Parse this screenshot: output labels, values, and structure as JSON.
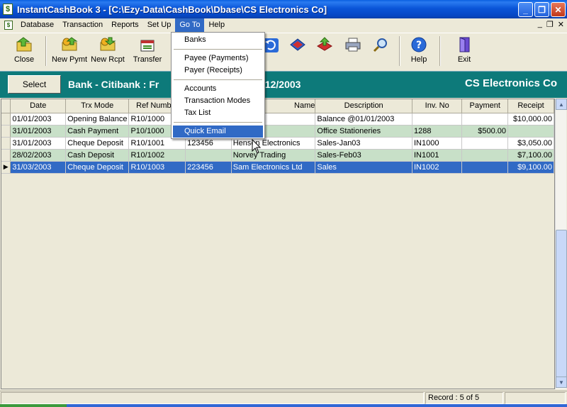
{
  "window": {
    "title": "InstantCashBook  3 - [C:\\Ezy-Data\\CashBook\\Dbase\\CS Electronics Co]",
    "app_icon_glyph": "$",
    "minimize_glyph": "_",
    "restore_glyph": "❐",
    "close_glyph": "✕"
  },
  "menubar": {
    "items": [
      "Database",
      "Transaction",
      "Reports",
      "Set Up",
      "Go To",
      "Help"
    ],
    "active": "Go To",
    "mdi_min": "_",
    "mdi_restore": "❐",
    "mdi_close": "✕"
  },
  "toolbar": {
    "close": "Close",
    "new_pymt": "New Pymt",
    "new_rcpt": "New Rcpt",
    "transfer": "Transfer",
    "help": "Help",
    "exit": "Exit"
  },
  "header": {
    "select_label": "Select",
    "bank_title": "Bank - Citibank  :  Fr",
    "date_tail": "31/12/2003",
    "company": "CS Electronics Co"
  },
  "grid": {
    "columns": [
      "Date",
      "Trx Mode",
      "Ref Number",
      "",
      "Name",
      "Description",
      "Inv. No",
      "Payment",
      "Receipt"
    ],
    "rows": [
      {
        "date": "01/01/2003",
        "mode": "Opening Balance",
        "ref": "R10/1000",
        "chq": "",
        "name": "",
        "desc": "Balance @01/01/2003",
        "inv": "",
        "payment": "",
        "receipt": "$10,000.00",
        "style": "white"
      },
      {
        "date": "31/01/2003",
        "mode": "Cash Payment",
        "ref": "P10/1000",
        "chq": "",
        "name": "eries",
        "desc": "Office Stationeries",
        "inv": "1288",
        "payment": "$500.00",
        "receipt": "",
        "style": "green"
      },
      {
        "date": "31/01/2003",
        "mode": "Cheque Deposit",
        "ref": "R10/1001",
        "chq": "123456",
        "name": "Henson Electronics",
        "desc": "Sales-Jan03",
        "inv": "IN1000",
        "payment": "",
        "receipt": "$3,050.00",
        "style": "white"
      },
      {
        "date": "28/02/2003",
        "mode": "Cash Deposit",
        "ref": "R10/1002",
        "chq": "",
        "name": "Norvey Trading",
        "desc": "Sales-Feb03",
        "inv": "IN1001",
        "payment": "",
        "receipt": "$7,100.00",
        "style": "green"
      },
      {
        "date": "31/03/2003",
        "mode": "Cheque Deposit",
        "ref": "R10/1003",
        "chq": "223456",
        "name": "Sam Electronics Ltd",
        "desc": "Sales",
        "inv": "IN1002",
        "payment": "",
        "receipt": "$9,100.00",
        "style": "sel"
      }
    ]
  },
  "goto_menu": {
    "items": [
      "Banks",
      "Payee (Payments)",
      "Payer (Receipts)",
      "Accounts",
      "Transaction Modes",
      "Tax List",
      "Quick Email"
    ],
    "highlighted": "Quick Email"
  },
  "status": {
    "record": "Record : 5 of 5"
  }
}
